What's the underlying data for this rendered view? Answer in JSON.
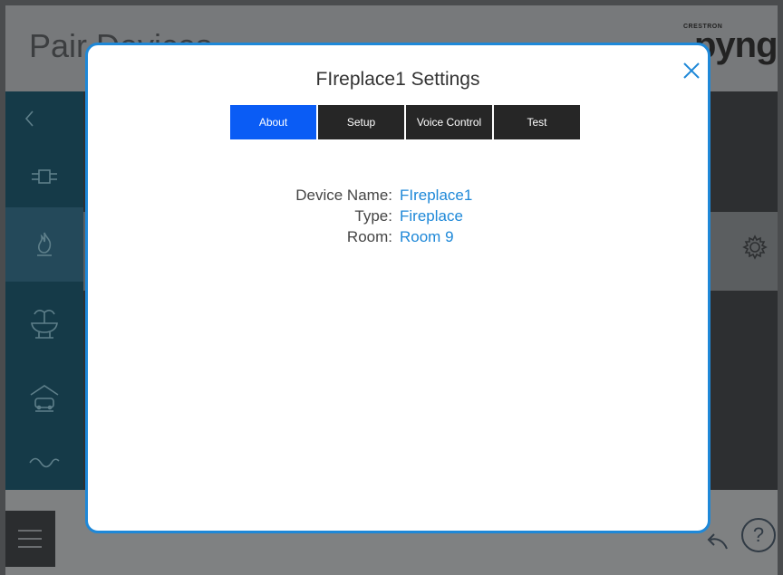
{
  "background": {
    "page_title": "Pair Devices",
    "brand_small": "CRESTRON",
    "brand": "pyng",
    "help_label": "?"
  },
  "modal": {
    "title": "FIreplace1 Settings",
    "close_icon": "close-icon",
    "tabs": [
      {
        "label": "About",
        "active": true
      },
      {
        "label": "Setup",
        "active": false
      },
      {
        "label": "Voice Control",
        "active": false
      },
      {
        "label": "Test",
        "active": false
      }
    ],
    "info": [
      {
        "label": "Device Name:",
        "value": "FIreplace1"
      },
      {
        "label": "Type:",
        "value": "Fireplace"
      },
      {
        "label": "Room:",
        "value": "Room 9"
      }
    ]
  },
  "colors": {
    "accent": "#1e88d8",
    "active_tab": "#0a5cf5",
    "tab": "#262626"
  }
}
